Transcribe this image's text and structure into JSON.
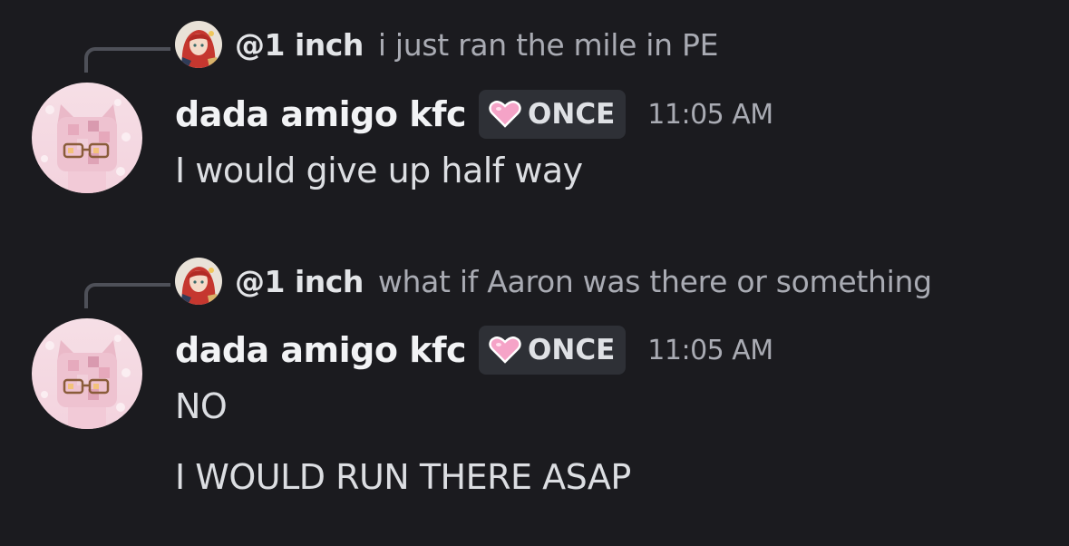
{
  "messages": [
    {
      "reply": {
        "author": "@1 inch",
        "text": "i just ran the mile in PE"
      },
      "author": "dada amigo kfc",
      "tag": {
        "icon": "pink-heart-icon",
        "label": "ONCE"
      },
      "timestamp": "11:05 AM",
      "lines": [
        "I would give up half way"
      ]
    },
    {
      "reply": {
        "author": "@1 inch",
        "text": "what if Aaron was there or something"
      },
      "author": "dada amigo kfc",
      "tag": {
        "icon": "pink-heart-icon",
        "label": "ONCE"
      },
      "timestamp": "11:05 AM",
      "lines": [
        "NO",
        "I WOULD RUN THERE ASAP"
      ]
    }
  ],
  "colors": {
    "background": "#1b1b1f",
    "tag_background": "#2e3036",
    "heart": "#f5a3c7"
  }
}
